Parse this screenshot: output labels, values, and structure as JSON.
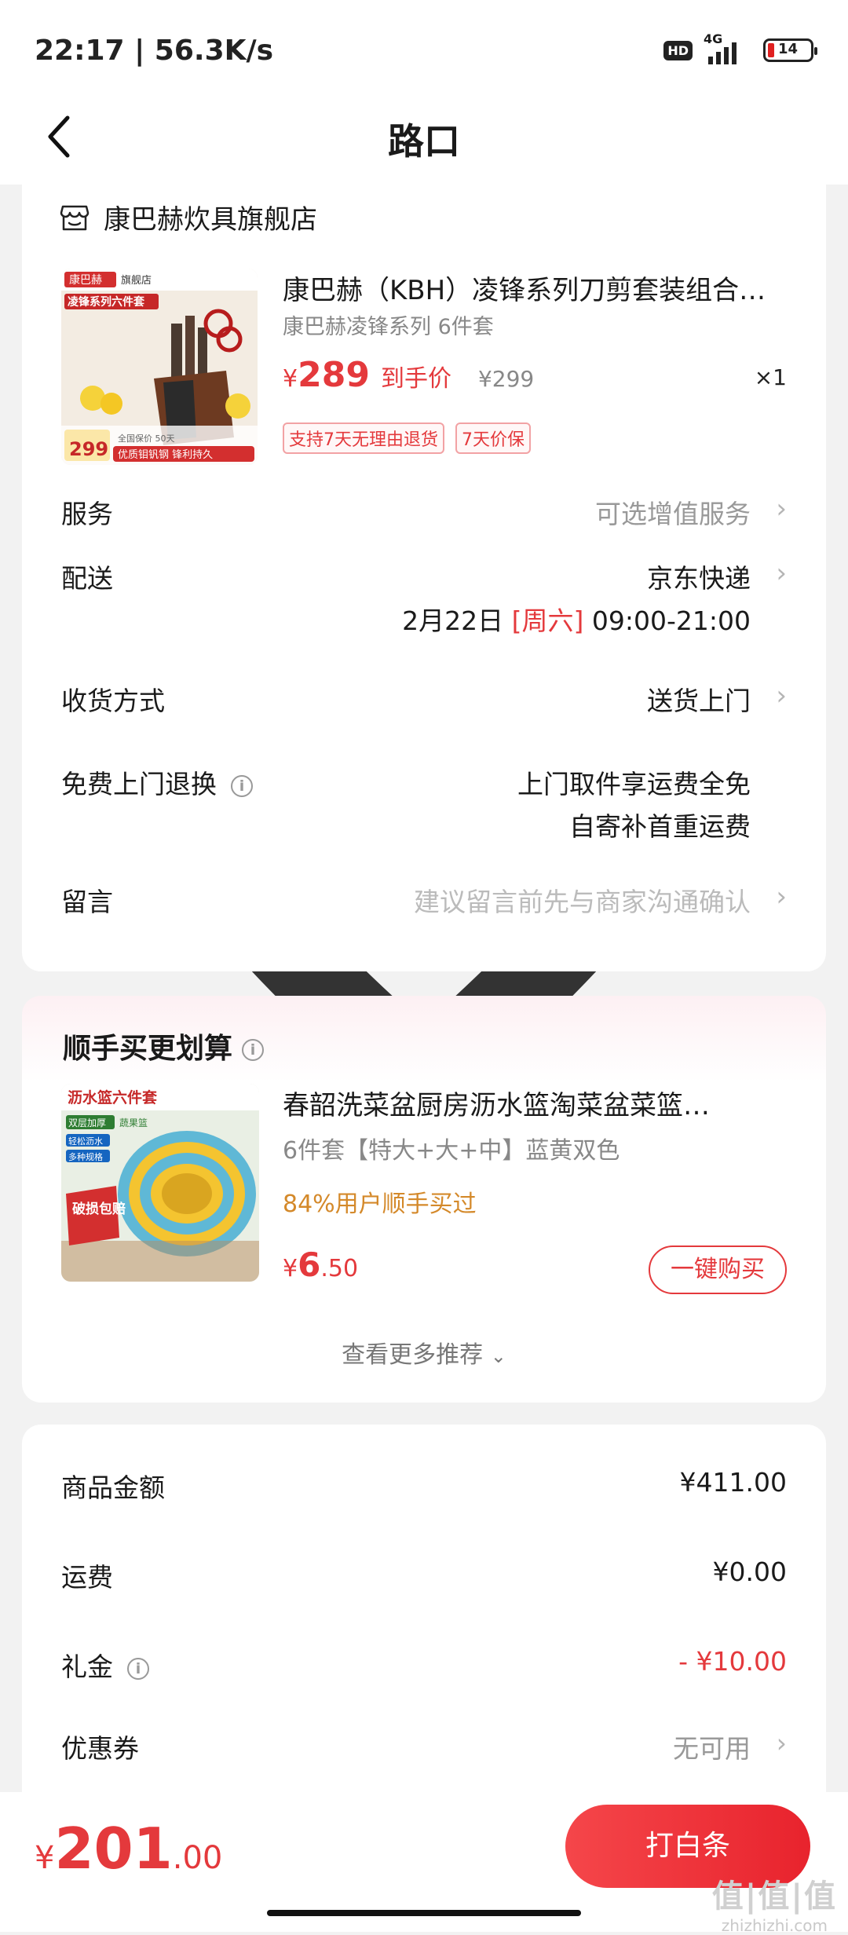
{
  "status_bar": {
    "time": "22:17 | 56.3K/s",
    "hd": "HD",
    "network": "4G",
    "battery": "14"
  },
  "nav": {
    "title": "路口",
    "back_icon": "chevron-left-icon",
    "location_icon": "location-pin-icon"
  },
  "store": {
    "name": "康巴赫炊具旗舰店",
    "icon": "store-icon"
  },
  "product": {
    "title": "康巴赫（KBH）凌锋系列刀剪套装组合…",
    "spec": "康巴赫凌锋系列 6件套",
    "price_symbol": "¥",
    "price": "289",
    "price_label": "到手价",
    "original_price": "¥299",
    "quantity": "×1",
    "tags": [
      "支持7天无理由退货",
      "7天价保"
    ],
    "image": {
      "brand": "康巴赫",
      "store_badge": "旗舰店",
      "series": "凌锋系列六件套",
      "price_badge": "299",
      "slogan": "优质钼钒钢 锋利持久",
      "sub": "全国保价 50天"
    }
  },
  "rows": {
    "service": {
      "label": "服务",
      "value": "可选增值服务"
    },
    "delivery": {
      "label": "配送",
      "value": "京东快递",
      "date": "2月22日",
      "weekday": "[周六]",
      "time": "09:00-21:00"
    },
    "receive": {
      "label": "收货方式",
      "value": "送货上门"
    },
    "free_return": {
      "label": "免费上门退换",
      "line1": "上门取件享运费全免",
      "line2": "自寄补首重运费"
    },
    "message": {
      "label": "留言",
      "placeholder": "建议留言前先与商家沟通确认"
    }
  },
  "recommend": {
    "title": "顺手买更划算",
    "item": {
      "title": "春韶洗菜盆厨房沥水篮淘菜盆菜篮…",
      "spec": "6件套【特大+大+中】蓝黄双色",
      "users": "84%用户顺手买过",
      "price_symbol": "¥",
      "price_int": "6",
      "price_dec": ".50",
      "buy_label": "一键购买",
      "image": {
        "headline": "沥水篮六件套",
        "tag1": "双层加厚",
        "tag2": "蔬果篮",
        "tag3": "轻松沥水",
        "tag4": "多种规格",
        "badge": "破损包赔"
      }
    },
    "more_label": "查看更多推荐"
  },
  "summary": {
    "goods": {
      "label": "商品金额",
      "value": "¥411.00"
    },
    "shipping": {
      "label": "运费",
      "value": "¥0.00"
    },
    "gift": {
      "label": "礼金",
      "value": "- ¥10.00"
    },
    "coupon": {
      "label": "优惠券",
      "value": "无可用"
    }
  },
  "bottom": {
    "symbol": "¥",
    "total_int": "201",
    "total_dec": ".00",
    "pay_label": "打白条"
  },
  "watermark": {
    "logo": "值|值|值",
    "site": "zhizhizhi.com"
  },
  "colors": {
    "accent": "#e4393c",
    "orange": "#d4892a",
    "background": "#f2f2f2"
  }
}
